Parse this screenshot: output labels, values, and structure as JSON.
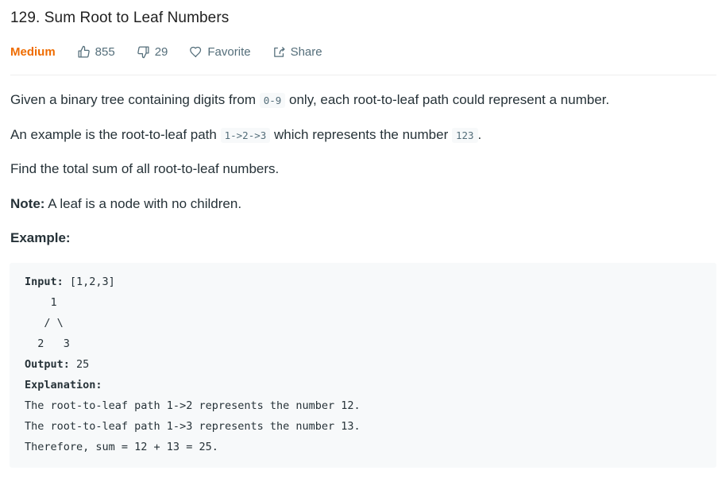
{
  "problem": {
    "title": "129. Sum Root to Leaf Numbers",
    "difficulty": "Medium",
    "likes": "855",
    "dislikes": "29",
    "favorite_label": "Favorite",
    "share_label": "Share"
  },
  "description": {
    "p1_before": "Given a binary tree containing digits from ",
    "p1_code": "0-9",
    "p1_after": " only, each root-to-leaf path could represent a number.",
    "p2_before": "An example is the root-to-leaf path ",
    "p2_code1": "1->2->3",
    "p2_middle": " which represents the number ",
    "p2_code2": "123",
    "p2_after": ".",
    "p3": "Find the total sum of all root-to-leaf numbers.",
    "note_label": "Note:",
    "note_text": " A leaf is a node with no children.",
    "example_heading": "Example:"
  },
  "example": {
    "input_label": "Input:",
    "input_value": " [1,2,3]",
    "tree_line1": "    1",
    "tree_line2": "   / \\",
    "tree_line3": "  2   3",
    "output_label": "Output:",
    "output_value": " 25",
    "explanation_label": "Explanation:",
    "line1": "The root-to-leaf path 1->2 represents the number 12.",
    "line2": "The root-to-leaf path 1->3 represents the number 13.",
    "line3": "Therefore, sum = 12 + 13 = 25."
  },
  "colors": {
    "difficulty_medium": "#ef6c00",
    "meta_text": "#546e7a",
    "body_text": "#263238",
    "code_bg": "#f7f9fa"
  },
  "icons": {
    "like": "thumbs-up-icon",
    "dislike": "thumbs-down-icon",
    "favorite": "heart-icon",
    "share": "share-icon"
  }
}
